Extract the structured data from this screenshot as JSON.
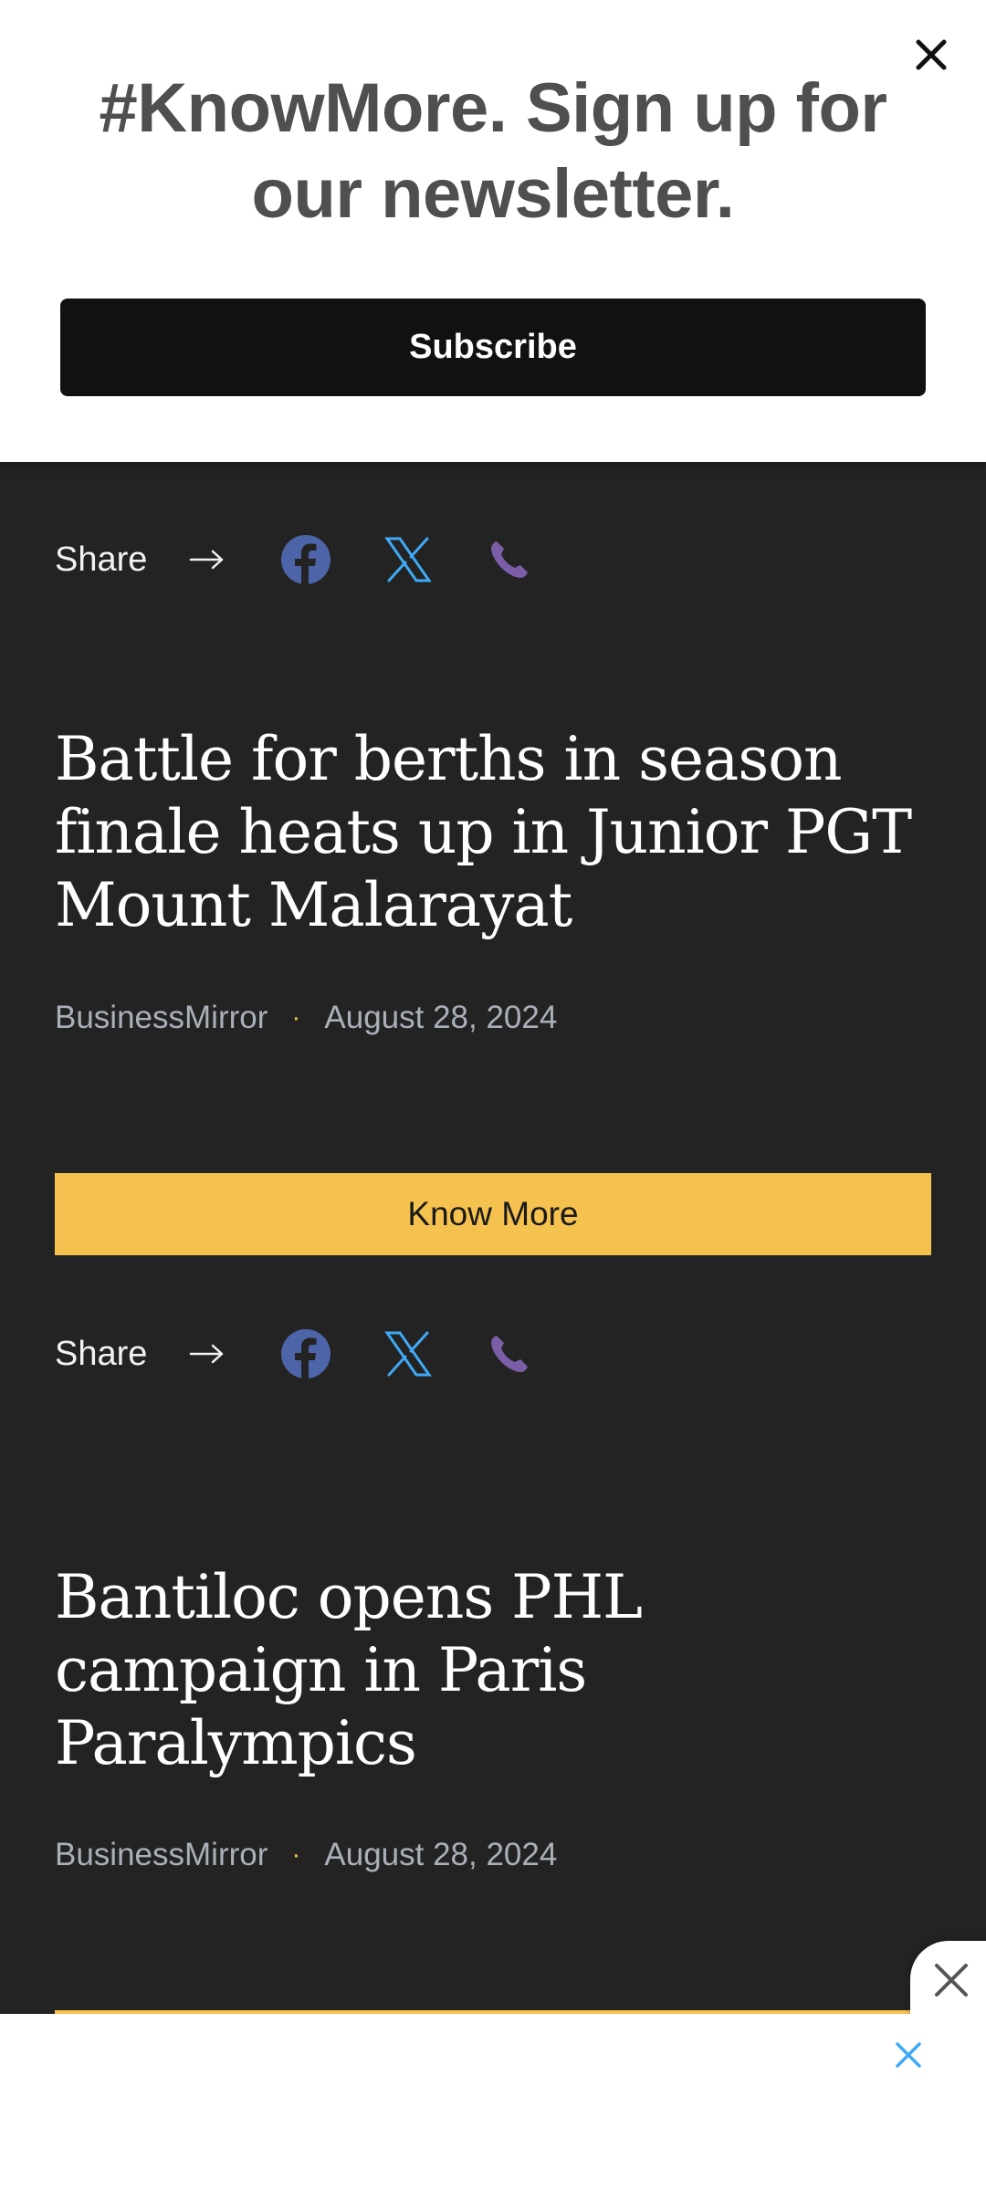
{
  "newsletter": {
    "title": "#KnowMore. Sign up for our newsletter.",
    "subscribe_label": "Subscribe"
  },
  "share": {
    "label": "Share"
  },
  "articles": [
    {
      "title": "Battle for berths in season finale heats up in Junior PGT Mount Malarayat",
      "source": "BusinessMirror",
      "date": "August 28, 2024",
      "know_more_label": "Know More"
    },
    {
      "title": "Bantiloc opens PHL campaign in Paris Paralympics",
      "source": "BusinessMirror",
      "date": "August 28, 2024"
    }
  ],
  "colors": {
    "accent": "#f6c24f",
    "background": "#232323",
    "facebook": "#4d65a8",
    "x": "#3fa9f5",
    "phone": "#7b5ea7"
  },
  "icons": [
    "close-icon",
    "arrow-right-icon",
    "facebook-icon",
    "x-icon",
    "phone-icon"
  ]
}
